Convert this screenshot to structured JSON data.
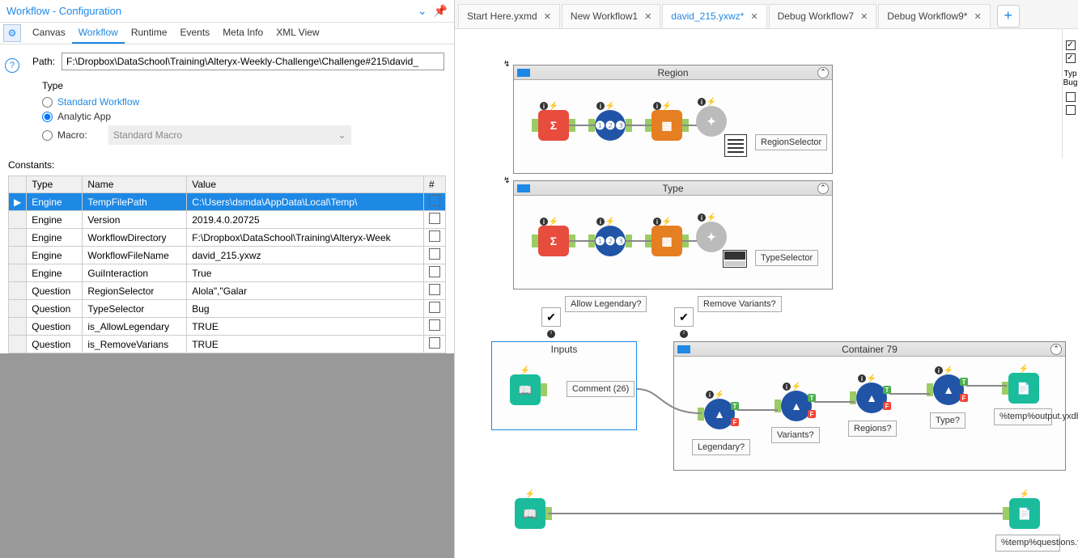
{
  "panel": {
    "title": "Workflow - Configuration",
    "tabs": [
      "Canvas",
      "Workflow",
      "Runtime",
      "Events",
      "Meta Info",
      "XML View"
    ],
    "active_tab": "Workflow",
    "path_label": "Path:",
    "path_value": "F:\\Dropbox\\DataSchool\\Training\\Alteryx-Weekly-Challenge\\Challenge#215\\david_",
    "type_label": "Type",
    "type_options": {
      "standard": "Standard Workflow",
      "analytic": "Analytic App",
      "macro": "Macro:"
    },
    "macro_placeholder": "Standard Macro",
    "constants_label": "Constants:"
  },
  "table": {
    "headers": {
      "type": "Type",
      "name": "Name",
      "value": "Value",
      "hash": "#"
    },
    "rows": [
      {
        "type": "Engine",
        "name": "TempFilePath",
        "value": "C:\\Users\\dsmda\\AppData\\Local\\Temp\\",
        "selected": true
      },
      {
        "type": "Engine",
        "name": "Version",
        "value": "2019.4.0.20725"
      },
      {
        "type": "Engine",
        "name": "WorkflowDirectory",
        "value": "F:\\Dropbox\\DataSchool\\Training\\Alteryx-Week"
      },
      {
        "type": "Engine",
        "name": "WorkflowFileName",
        "value": "david_215.yxwz"
      },
      {
        "type": "Engine",
        "name": "GuiInteraction",
        "value": "True"
      },
      {
        "type": "Question",
        "name": "RegionSelector",
        "value": "Alola\",\"Galar"
      },
      {
        "type": "Question",
        "name": "TypeSelector",
        "value": "Bug"
      },
      {
        "type": "Question",
        "name": "is_AllowLegendary",
        "value": "TRUE"
      },
      {
        "type": "Question",
        "name": "is_RemoveVarians",
        "value": "TRUE"
      }
    ]
  },
  "doc_tabs": [
    {
      "label": "Start Here.yxmd"
    },
    {
      "label": "New Workflow1"
    },
    {
      "label": "david_215.yxwz*",
      "active": true
    },
    {
      "label": "Debug Workflow7"
    },
    {
      "label": "Debug Workflow9*"
    }
  ],
  "containers": {
    "region": {
      "title": "Region",
      "label": "RegionSelector"
    },
    "type": {
      "title": "Type",
      "label": "TypeSelector"
    },
    "inputs": {
      "title": "Inputs",
      "comment": "Comment (26)"
    },
    "c79": {
      "title": "Container 79"
    }
  },
  "node_labels": {
    "allow_legendary": "Allow Legendary?",
    "remove_variants": "Remove Variants?",
    "legendary": "Legendary?",
    "variants": "Variants?",
    "regions": "Regions?",
    "type": "Type?",
    "output1": "%temp%output.yxdb",
    "output2": "%temp%questions.yxdb"
  },
  "right_strip": {
    "typ": "Typ",
    "bug": "Bug"
  }
}
